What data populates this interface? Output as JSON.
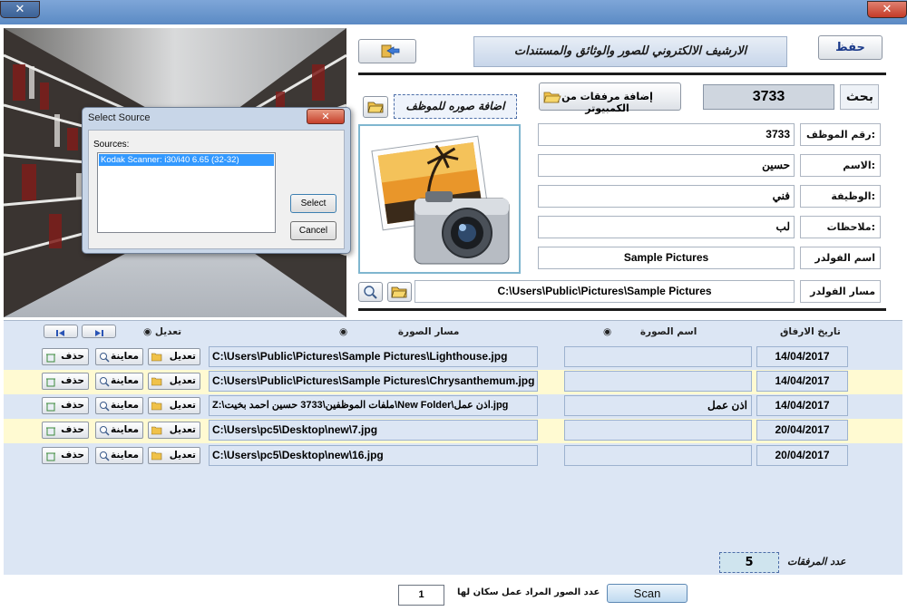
{
  "window": {
    "close_symbol": "✕",
    "minimize_symbol": "✕"
  },
  "dialog": {
    "title": "Select Source",
    "close_symbol": "✕",
    "sources_label": "Sources:",
    "source_item": "Kodak Scanner: i30/i40 6.65 (32-32)",
    "select_label": "Select",
    "cancel_label": "Cancel"
  },
  "header": {
    "save_label": "حفظ",
    "banner_title": "الارشيف الالكتروني للصور والوثائق والمستندات",
    "exit_icon": "exit-arrow-icon"
  },
  "search": {
    "label": "بحث",
    "value": "3733",
    "add_attachments_label": "إضافة مرفقات من الكمبيوتر",
    "add_photo_label": "اضافة صوره للموظف"
  },
  "form": {
    "employee_no_label": "رقم الموظف:",
    "employee_no": "3733",
    "name_label": "الاسم:",
    "name": "حسين",
    "job_label": "الوظيفة:",
    "job": "فني",
    "notes_label": "ملاحظات:",
    "notes": "لب",
    "folder_name_label": "اسم الفولدر",
    "folder_name": "Sample Pictures",
    "folder_path_label": "مسار الفولدر",
    "folder_path": "C:\\Users\\Public\\Pictures\\Sample Pictures"
  },
  "grid": {
    "col_date": "تاريخ الارفاق",
    "col_image_name": "اسم الصورة",
    "col_image_path": "مسار الصورة",
    "col_edit": "تعديل",
    "btn_edit": "تعديل",
    "btn_preview": "معاينة",
    "btn_delete": "حذف",
    "rows": [
      {
        "path": "C:\\Users\\Public\\Pictures\\Sample Pictures\\Lighthouse.jpg",
        "name": "",
        "date": "14/04/2017"
      },
      {
        "path": "C:\\Users\\Public\\Pictures\\Sample Pictures\\Chrysanthemum.jpg",
        "name": "",
        "date": "14/04/2017"
      },
      {
        "path": "Z:\\ملفات الموظفين\\3733 حسين احمد بخيت\\New Folder\\اذن عمل.jpg",
        "name": "اذن عمل",
        "date": "14/04/2017"
      },
      {
        "path": "C:\\Users\\pc5\\Desktop\\new\\7.jpg",
        "name": "",
        "date": "20/04/2017"
      },
      {
        "path": "C:\\Users\\pc5\\Desktop\\new\\16.jpg",
        "name": "",
        "date": "20/04/2017"
      }
    ]
  },
  "summary": {
    "count_label": "عدد المرفقات",
    "count": "5"
  },
  "scan": {
    "pages_label": "عدد الصور المراد عمل سكان لها",
    "pages": "1",
    "scan_label": "Scan"
  },
  "colors": {
    "accent": "#5b8ac4",
    "row_alt": "#fffad2",
    "grid_bg": "#dce6f4"
  }
}
